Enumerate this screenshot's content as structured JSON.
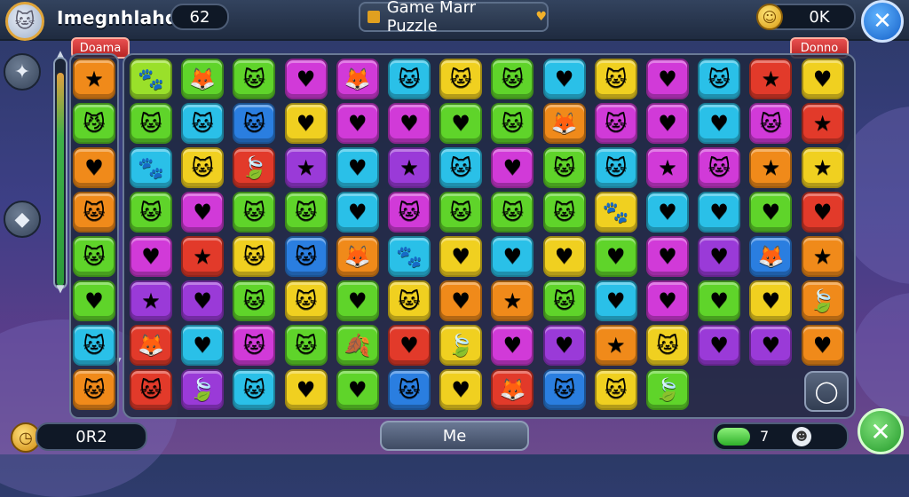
{
  "header": {
    "player_name": "Imegnhlahdh:",
    "player_score": "62",
    "title": "Game Marr Puzzle",
    "coins": "0K"
  },
  "tags": {
    "left": "Doama",
    "right": "Donno"
  },
  "footer": {
    "timer": "0R2",
    "center_button": "Me",
    "progress_count": "7",
    "progress_fraction": 0.25
  },
  "icons": {
    "avatar": "cat-avatar-icon",
    "coin": "coin-icon",
    "close_top": "close-icon",
    "side_top": "puzzle-icon",
    "side_mid": "diamond-icon",
    "timer": "clock-icon",
    "progress": "cat-icon",
    "close_bottom": "close-icon",
    "ring": "ring-icon"
  },
  "colors": {
    "green": "#5fd42a",
    "orange": "#f08a1a",
    "red": "#e23a2a",
    "purple": "#9a3ad8",
    "magenta": "#d13ad8",
    "cyan": "#2ac0e8",
    "blue": "#2a7ee0",
    "yellow": "#f0d020",
    "lime": "#9ae02a"
  },
  "left_column": [
    {
      "color": "orange",
      "glyph": "★"
    },
    {
      "color": "green",
      "glyph": "😼"
    },
    {
      "color": "orange",
      "glyph": "♥"
    },
    {
      "color": "orange",
      "glyph": "🐱"
    },
    {
      "color": "green",
      "glyph": "🐱"
    },
    {
      "color": "green",
      "glyph": "♥"
    },
    {
      "color": "cyan",
      "glyph": "🐱"
    },
    {
      "color": "orange",
      "glyph": "🐱"
    }
  ],
  "board": [
    [
      {
        "color": "lime",
        "glyph": "🐾"
      },
      {
        "color": "green",
        "glyph": "🦊"
      },
      {
        "color": "green",
        "glyph": "🐱"
      },
      {
        "color": "magenta",
        "glyph": "♥"
      },
      {
        "color": "magenta",
        "glyph": "🦊"
      },
      {
        "color": "cyan",
        "glyph": "🐱"
      },
      {
        "color": "yellow",
        "glyph": "🐱"
      },
      {
        "color": "green",
        "glyph": "🐱"
      },
      {
        "color": "cyan",
        "glyph": "♥"
      },
      {
        "color": "yellow",
        "glyph": "🐱"
      },
      {
        "color": "magenta",
        "glyph": "♥"
      },
      {
        "color": "cyan",
        "glyph": "🐱"
      },
      {
        "color": "red",
        "glyph": "★"
      },
      {
        "color": "yellow",
        "glyph": "♥"
      }
    ],
    [
      {
        "color": "green",
        "glyph": "🐱"
      },
      {
        "color": "cyan",
        "glyph": "🐱"
      },
      {
        "color": "blue",
        "glyph": "🐱"
      },
      {
        "color": "yellow",
        "glyph": "♥"
      },
      {
        "color": "magenta",
        "glyph": "♥"
      },
      {
        "color": "magenta",
        "glyph": "♥"
      },
      {
        "color": "green",
        "glyph": "♥"
      },
      {
        "color": "green",
        "glyph": "🐱"
      },
      {
        "color": "orange",
        "glyph": "🦊"
      },
      {
        "color": "magenta",
        "glyph": "🐱"
      },
      {
        "color": "magenta",
        "glyph": "♥"
      },
      {
        "color": "cyan",
        "glyph": "♥"
      },
      {
        "color": "magenta",
        "glyph": "🐱"
      },
      {
        "color": "red",
        "glyph": "★"
      }
    ],
    [
      {
        "color": "cyan",
        "glyph": "🐾"
      },
      {
        "color": "yellow",
        "glyph": "🐱"
      },
      {
        "color": "red",
        "glyph": "🍃"
      },
      {
        "color": "purple",
        "glyph": "★"
      },
      {
        "color": "cyan",
        "glyph": "♥"
      },
      {
        "color": "purple",
        "glyph": "★"
      },
      {
        "color": "cyan",
        "glyph": "🐱"
      },
      {
        "color": "magenta",
        "glyph": "♥"
      },
      {
        "color": "green",
        "glyph": "🐱"
      },
      {
        "color": "cyan",
        "glyph": "🐱"
      },
      {
        "color": "magenta",
        "glyph": "★"
      },
      {
        "color": "magenta",
        "glyph": "🐱"
      },
      {
        "color": "orange",
        "glyph": "★"
      },
      {
        "color": "yellow",
        "glyph": "★"
      }
    ],
    [
      {
        "color": "green",
        "glyph": "🐱"
      },
      {
        "color": "magenta",
        "glyph": "♥"
      },
      {
        "color": "green",
        "glyph": "🐱"
      },
      {
        "color": "green",
        "glyph": "🐱"
      },
      {
        "color": "cyan",
        "glyph": "♥"
      },
      {
        "color": "magenta",
        "glyph": "🐱"
      },
      {
        "color": "green",
        "glyph": "🐱"
      },
      {
        "color": "green",
        "glyph": "🐱"
      },
      {
        "color": "green",
        "glyph": "🐱"
      },
      {
        "color": "yellow",
        "glyph": "🐾"
      },
      {
        "color": "cyan",
        "glyph": "♥"
      },
      {
        "color": "cyan",
        "glyph": "♥"
      },
      {
        "color": "green",
        "glyph": "♥"
      },
      {
        "color": "red",
        "glyph": "♥"
      }
    ],
    [
      {
        "color": "magenta",
        "glyph": "♥"
      },
      {
        "color": "red",
        "glyph": "★"
      },
      {
        "color": "yellow",
        "glyph": "🐱"
      },
      {
        "color": "blue",
        "glyph": "🐱"
      },
      {
        "color": "orange",
        "glyph": "🦊"
      },
      {
        "color": "cyan",
        "glyph": "🐾"
      },
      {
        "color": "yellow",
        "glyph": "♥"
      },
      {
        "color": "cyan",
        "glyph": "♥"
      },
      {
        "color": "yellow",
        "glyph": "♥"
      },
      {
        "color": "green",
        "glyph": "♥"
      },
      {
        "color": "magenta",
        "glyph": "♥"
      },
      {
        "color": "purple",
        "glyph": "♥"
      },
      {
        "color": "blue",
        "glyph": "🦊"
      },
      {
        "color": "orange",
        "glyph": "★"
      }
    ],
    [
      {
        "color": "purple",
        "glyph": "★"
      },
      {
        "color": "purple",
        "glyph": "♥"
      },
      {
        "color": "green",
        "glyph": "🐱"
      },
      {
        "color": "yellow",
        "glyph": "🐱"
      },
      {
        "color": "green",
        "glyph": "♥"
      },
      {
        "color": "yellow",
        "glyph": "🐱"
      },
      {
        "color": "orange",
        "glyph": "♥"
      },
      {
        "color": "orange",
        "glyph": "★"
      },
      {
        "color": "green",
        "glyph": "🐱"
      },
      {
        "color": "cyan",
        "glyph": "♥"
      },
      {
        "color": "magenta",
        "glyph": "♥"
      },
      {
        "color": "green",
        "glyph": "♥"
      },
      {
        "color": "yellow",
        "glyph": "♥"
      },
      {
        "color": "orange",
        "glyph": "🍃"
      }
    ],
    [
      {
        "color": "red",
        "glyph": "🦊"
      },
      {
        "color": "cyan",
        "glyph": "♥"
      },
      {
        "color": "magenta",
        "glyph": "🐱"
      },
      {
        "color": "green",
        "glyph": "🐱"
      },
      {
        "color": "green",
        "glyph": "🍂"
      },
      {
        "color": "red",
        "glyph": "♥"
      },
      {
        "color": "yellow",
        "glyph": "🍃"
      },
      {
        "color": "magenta",
        "glyph": "♥"
      },
      {
        "color": "purple",
        "glyph": "♥"
      },
      {
        "color": "orange",
        "glyph": "★"
      },
      {
        "color": "yellow",
        "glyph": "🐱"
      },
      {
        "color": "purple",
        "glyph": "♥"
      },
      {
        "color": "purple",
        "glyph": "♥"
      },
      {
        "color": "orange",
        "glyph": "♥"
      }
    ],
    [
      {
        "color": "red",
        "glyph": "🐱"
      },
      {
        "color": "purple",
        "glyph": "🍃"
      },
      {
        "color": "cyan",
        "glyph": "🐱"
      },
      {
        "color": "yellow",
        "glyph": "♥"
      },
      {
        "color": "green",
        "glyph": "♥"
      },
      {
        "color": "blue",
        "glyph": "🐱"
      },
      {
        "color": "yellow",
        "glyph": "♥"
      },
      {
        "color": "red",
        "glyph": "🦊"
      },
      {
        "color": "blue",
        "glyph": "🐱"
      },
      {
        "color": "yellow",
        "glyph": "🐱"
      },
      {
        "color": "green",
        "glyph": "🍃"
      }
    ]
  ]
}
